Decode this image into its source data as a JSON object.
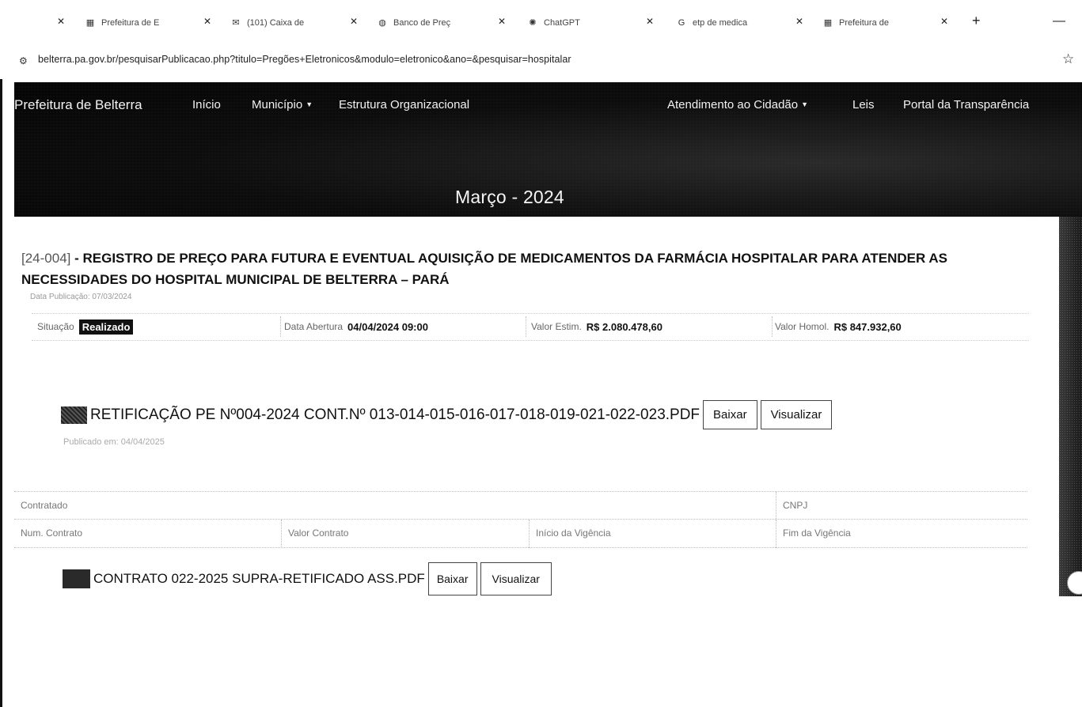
{
  "browser": {
    "tabs": [
      {
        "label": "Prefeitura de E",
        "icon": "building-icon"
      },
      {
        "label": "(101) Caixa de",
        "icon": "mail-icon"
      },
      {
        "label": "Banco de Preç",
        "icon": "globe-icon"
      },
      {
        "label": "ChatGPT",
        "icon": "chatgpt-icon"
      },
      {
        "label": "etp de medica",
        "icon": "google-icon"
      },
      {
        "label": "Prefeitura de",
        "icon": "building-icon"
      }
    ],
    "url": "belterra.pa.gov.br/pesquisarPublicacao.php?titulo=Pregões+Eletronicos&modulo=eletronico&ano=&pesquisar=hospitalar"
  },
  "nav": {
    "brand": "Prefeitura de Belterra",
    "items": [
      "Início",
      "Município",
      "Estrutura Organizacional",
      "Atendimento ao Cidadão",
      "Leis",
      "Portal da Transparência"
    ]
  },
  "hero": {
    "title": "Março - 2024"
  },
  "item": {
    "code": "[24-004]",
    "title": " - REGISTRO DE PREÇO PARA FUTURA E EVENTUAL AQUISIÇÃO DE MEDICAMENTOS DA FARMÁCIA HOSPITALAR PARA ATENDER AS NECESSIDADES DO HOSPITAL MUNICIPAL DE BELTERRA – PARÁ",
    "pubdate": "Data Publicação: 07/03/2024",
    "situacao_label": "Situação",
    "situacao_value": "Realizado",
    "abertura_label": "Data Abertura",
    "abertura_value": "04/04/2024 09:00",
    "estim_label": "Valor Estim.",
    "estim_value": "R$ 2.080.478,60",
    "homol_label": "Valor Homol.",
    "homol_value": "R$ 847.932,60"
  },
  "documents": [
    {
      "name": "RETIFICAÇÃO PE Nº004-2024 CONT.Nº 013-014-015-016-017-018-019-021-022-023.PDF",
      "sub": "Publicado em: 04/04/2025",
      "download": "Baixar",
      "view": "Visualizar"
    },
    {
      "name": "CONTRATO 022-2025 SUPRA-RETIFICADO ASS.PDF",
      "download": "Baixar",
      "view": "Visualizar"
    }
  ],
  "contract": {
    "contratado": "Contratado",
    "cnpj": "CNPJ",
    "num_contrato": "Num. Contrato",
    "valor_contrato": "Valor Contrato",
    "inicio_vigencia": "Início da Vigência",
    "fim_vigencia": "Fim da Vigência"
  }
}
